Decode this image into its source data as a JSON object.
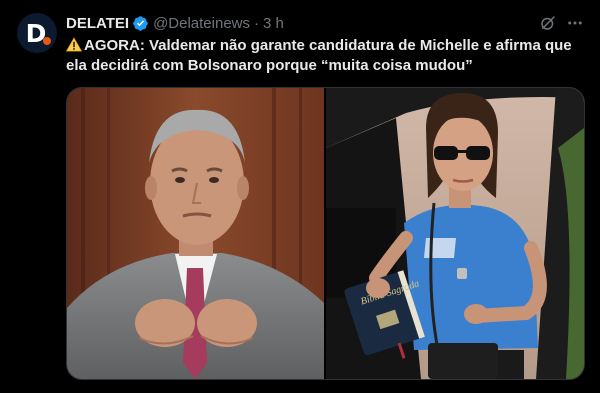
{
  "post": {
    "avatar_letter": "D",
    "author_name": "DELATEI",
    "author_handle": "@Delateinews",
    "separator": "·",
    "time": "3 h",
    "text": "AGORA: Valdemar não garante candidatura de Michelle e afirma que ela decidirá com Bolsonaro porque “muita coisa mudou”"
  },
  "icons": {
    "verified": "verified-badge-icon",
    "grok": "grok-icon",
    "more": "more-options-icon",
    "warning": "warning-icon"
  },
  "media": {
    "image_count": 2,
    "book_cover_text": "Bíblia Sagrada"
  },
  "colors": {
    "background": "#000000",
    "text": "#e7e9ea",
    "secondary_text": "#71767b",
    "verified": "#1d9bf0",
    "warning": "#ffcc4d"
  }
}
